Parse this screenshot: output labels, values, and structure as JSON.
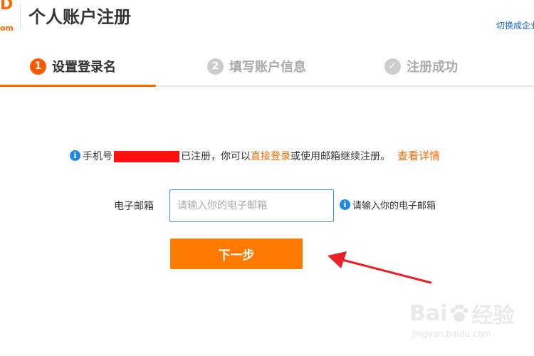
{
  "header": {
    "logo_fragment": "D",
    "logo_small": "om",
    "title": "个人账户注册",
    "switch_link": "切换成企业"
  },
  "steps": [
    {
      "number": "1",
      "label": "设置登录名",
      "state": "active"
    },
    {
      "number": "2",
      "label": "填写账户信息",
      "state": "pending"
    },
    {
      "number": "✓",
      "label": "注册成功",
      "state": "pending"
    }
  ],
  "notice": {
    "icon": "info-icon",
    "prefix": "手机号",
    "middle": "已注册，你可以",
    "login_link": "直接登录",
    "suffix": "或使用邮箱继续注册。",
    "details_link": "查看详情"
  },
  "form": {
    "email_label": "电子邮箱",
    "email_placeholder": "请输入你的电子邮箱",
    "email_value": "",
    "hint": "请输入你的电子邮箱",
    "next_button": "下一步"
  },
  "watermark": {
    "text_left": "Bai",
    "text_right": "经验",
    "url": "jingyan.baidu.com"
  },
  "colors": {
    "accent": "#ff6a00",
    "button": "#ff7a00",
    "link_blue": "#1463d4",
    "info_blue": "#1e88e5",
    "annotation_red": "#e8202a"
  }
}
